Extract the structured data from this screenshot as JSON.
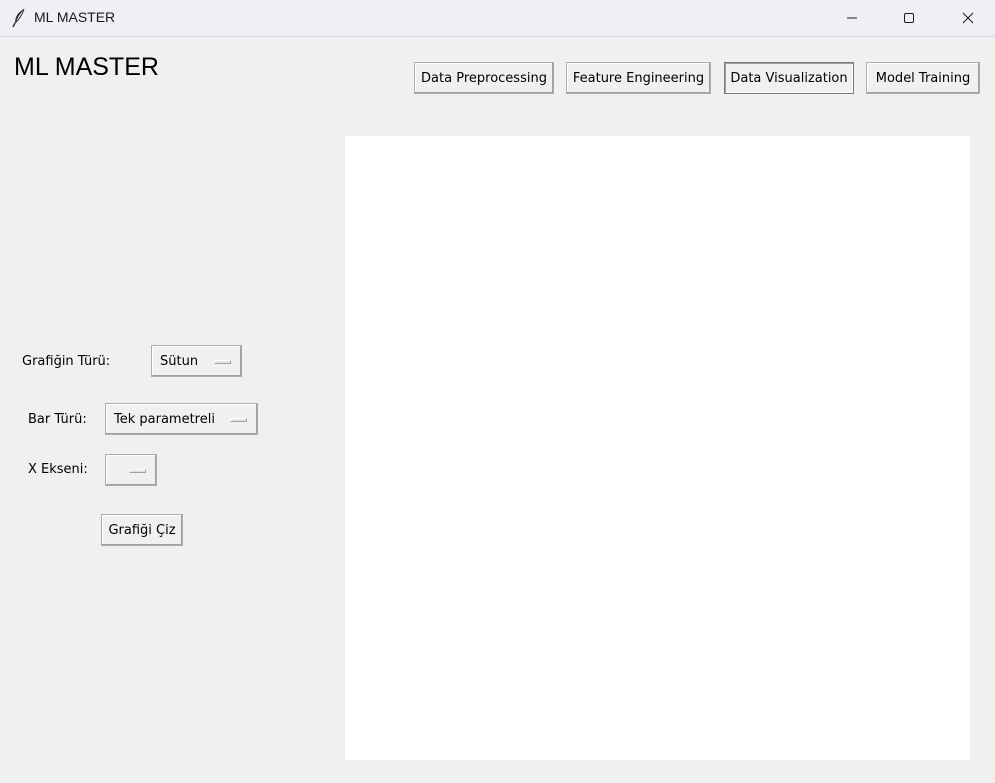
{
  "window": {
    "title": "ML MASTER",
    "icon": "feather-icon",
    "controls": [
      "minimize-icon",
      "maximize-icon",
      "close-icon"
    ]
  },
  "header": {
    "app_title": "ML MASTER",
    "nav": [
      {
        "label": "Data Preprocessing",
        "active": false
      },
      {
        "label": "Feature Engineering",
        "active": false
      },
      {
        "label": "Data Visualization",
        "active": true
      },
      {
        "label": "Model Training",
        "active": false
      }
    ]
  },
  "controls": {
    "chart_type": {
      "label": "Grafiğin Türü:",
      "value": "Sütun"
    },
    "bar_type": {
      "label": "Bar Türü:",
      "value": "Tek parametreli"
    },
    "x_axis": {
      "label": "X Ekseni:",
      "value": ""
    },
    "draw_button": "Grafiği Çiz"
  },
  "colors": {
    "background": "#f0f0f0",
    "titlebar": "#eef0f6",
    "canvas": "#ffffff"
  }
}
